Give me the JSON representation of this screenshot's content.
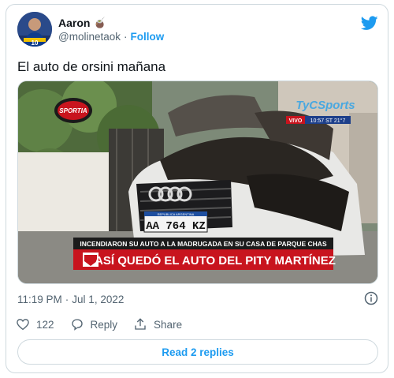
{
  "author": {
    "display_name": "Aaron",
    "name_emoji": "🧉",
    "handle": "@molinetaok",
    "separator": "·",
    "follow_label": "Follow"
  },
  "tweet": {
    "text": "El auto de orsini mañana"
  },
  "media": {
    "channel_top_left": "SPORTIA",
    "channel_logo": "TyCSports",
    "live_label": "VIVO",
    "clock": "10:57 ST 21°7",
    "plate": "AA 764 KZ",
    "plate_header": "REPUBLICA ARGENTINA",
    "chyron_top": "INCENDIARON SU AUTO A LA MADRUGADA EN SU CASA DE PARQUE CHAS",
    "chyron_main": "ASÍ QUEDÓ EL AUTO DEL PITY MARTÍNEZ"
  },
  "meta": {
    "time": "11:19 PM",
    "separator": "·",
    "date": "Jul 1, 2022"
  },
  "actions": {
    "like_count": "122",
    "reply_label": "Reply",
    "share_label": "Share"
  },
  "replies_button": "Read 2 replies",
  "colors": {
    "accent": "#1d9bf0",
    "secondary_text": "#536471",
    "border": "#cfd9de",
    "chyron_red": "#c8141e"
  }
}
